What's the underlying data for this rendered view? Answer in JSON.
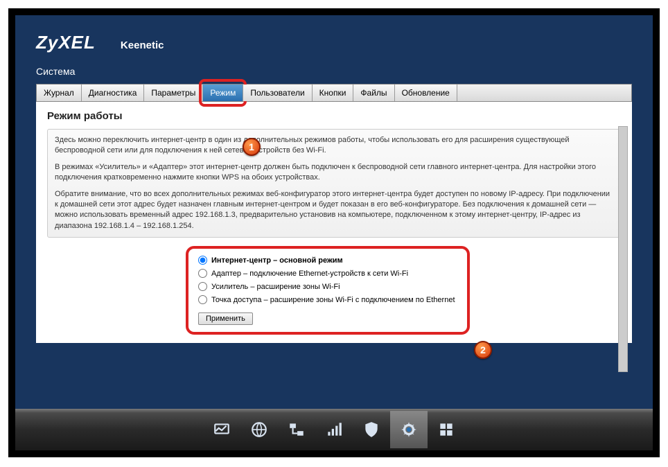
{
  "brand": "ZyXEL",
  "model": "Keenetic",
  "section": "Система",
  "tabs": [
    {
      "label": "Журнал"
    },
    {
      "label": "Диагностика"
    },
    {
      "label": "Параметры"
    },
    {
      "label": "Режим",
      "active": true
    },
    {
      "label": "Пользователи"
    },
    {
      "label": "Кнопки"
    },
    {
      "label": "Файлы"
    },
    {
      "label": "Обновление"
    }
  ],
  "page_heading": "Режим работы",
  "info": {
    "p1": "Здесь можно переключить интернет-центр в один из дополнительных режимов работы, чтобы использовать его для расширения существующей беспроводной сети или для подключения к ней сетевых устройств без Wi-Fi.",
    "p2": "В режимах «Усилитель» и «Адаптер» этот интернет-центр должен быть подключен к беспроводной сети главного интернет-центра. Для настройки этого подключения кратковременно нажмите кнопки WPS на обоих устройствах.",
    "p3": "Обратите внимание, что во всех дополнительных режимах веб-конфигуратор этого интернет-центра будет доступен по новому IP-адресу. При подключении к домашней сети этот адрес будет назначен главным интернет-центром и будет показан в его веб-конфигураторе. Без подключения к домашней сети — можно использовать временный адрес 192.168.1.3, предварительно установив на компьютере, подключенном к этому интернет-центру, IP-адрес из диапазона 192.168.1.4 – 192.168.1.254."
  },
  "modes": [
    {
      "label": "Интернет-центр – основной режим",
      "checked": true
    },
    {
      "label": "Адаптер – подключение Ethernet-устройств к сети Wi-Fi",
      "checked": false
    },
    {
      "label": "Усилитель – расширение зоны Wi-Fi",
      "checked": false
    },
    {
      "label": "Точка доступа – расширение зоны Wi-Fi с подключением по Ethernet",
      "checked": false
    }
  ],
  "apply_label": "Применить",
  "badges": {
    "one": "1",
    "two": "2"
  },
  "nav_icons": [
    "monitor-icon",
    "globe-icon",
    "network-icon",
    "wifi-icon",
    "shield-icon",
    "gear-icon",
    "apps-icon"
  ]
}
